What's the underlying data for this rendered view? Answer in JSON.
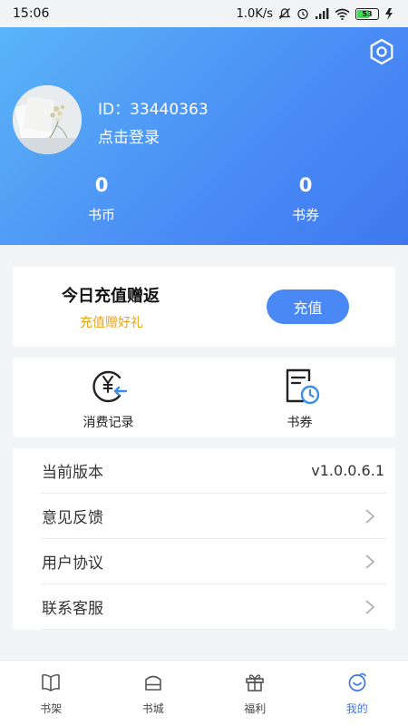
{
  "status_bar": {
    "time": "15:06",
    "speed": "1.0K/s",
    "battery": "53"
  },
  "profile": {
    "user_id": "ID：33440363",
    "login_text": "点击登录",
    "coins": {
      "value": "0",
      "label": "书币"
    },
    "vouchers": {
      "value": "0",
      "label": "书券"
    }
  },
  "recharge": {
    "title": "今日充值赠返",
    "subtitle": "充值赠好礼",
    "button": "充值"
  },
  "shortcuts": [
    {
      "label": "消费记录",
      "icon": "consumption-record-icon"
    },
    {
      "label": "书券",
      "icon": "voucher-clock-icon"
    }
  ],
  "settings_list": [
    {
      "label": "当前版本",
      "value": "v1.0.0.6.1"
    },
    {
      "label": "意见反馈"
    },
    {
      "label": "用户协议"
    },
    {
      "label": "联系客服"
    }
  ],
  "bottom_nav": [
    {
      "label": "书架",
      "icon": "bookshelf-icon",
      "active": false
    },
    {
      "label": "书城",
      "icon": "bookstore-icon",
      "active": false
    },
    {
      "label": "福利",
      "icon": "gift-icon",
      "active": false
    },
    {
      "label": "我的",
      "icon": "profile-icon",
      "active": true
    }
  ],
  "colors": {
    "accent": "#4a88f5",
    "header_start": "#5ab4f7",
    "header_end": "#3e78f0",
    "promo_text": "#e6a519"
  }
}
